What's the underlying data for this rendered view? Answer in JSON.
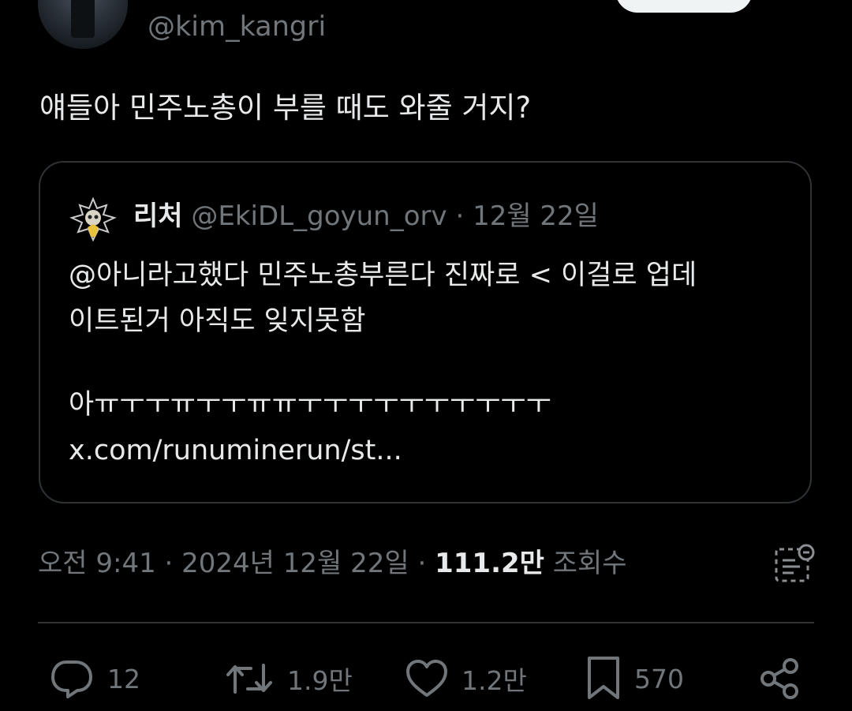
{
  "author": {
    "handle": "@kim_kangri"
  },
  "tweet": {
    "text": "얘들아 민주노총이 부를 때도 와줄 거지?"
  },
  "quoted": {
    "name": "리처",
    "handle": "@EkiDL_goyun_orv",
    "separator": "·",
    "date": "12월 22일",
    "lines": [
      "@아니라고했다 민주노총부른다 진짜로 < 이걸로 업데",
      "이트된거 아직도 잊지못함"
    ],
    "lines2": [
      "아ㅠㅜㅜㅠㅜㅜㅠㅠㅜㅜㅜㅜㅜㅜㅜㅜㅜㅜ",
      "x.com/runuminerun/st..."
    ]
  },
  "meta": {
    "time": "오전 9:41",
    "separator": "·",
    "date": "2024년 12월 22일",
    "separator2": "·",
    "views_count": "111.2만",
    "views_label": "조회수"
  },
  "actions": {
    "replies": "12",
    "retweets": "1.9만",
    "likes": "1.2만",
    "bookmarks": "570"
  },
  "icons": {
    "reply": "reply-icon",
    "retweet": "retweet-icon",
    "like": "heart-icon",
    "bookmark": "bookmark-icon",
    "share": "share-icon",
    "analytics": "grok-analytics-icon"
  },
  "colors": {
    "background": "#000000",
    "text": "#e7e9ea",
    "secondary": "#71767b",
    "border": "#2f3336"
  }
}
